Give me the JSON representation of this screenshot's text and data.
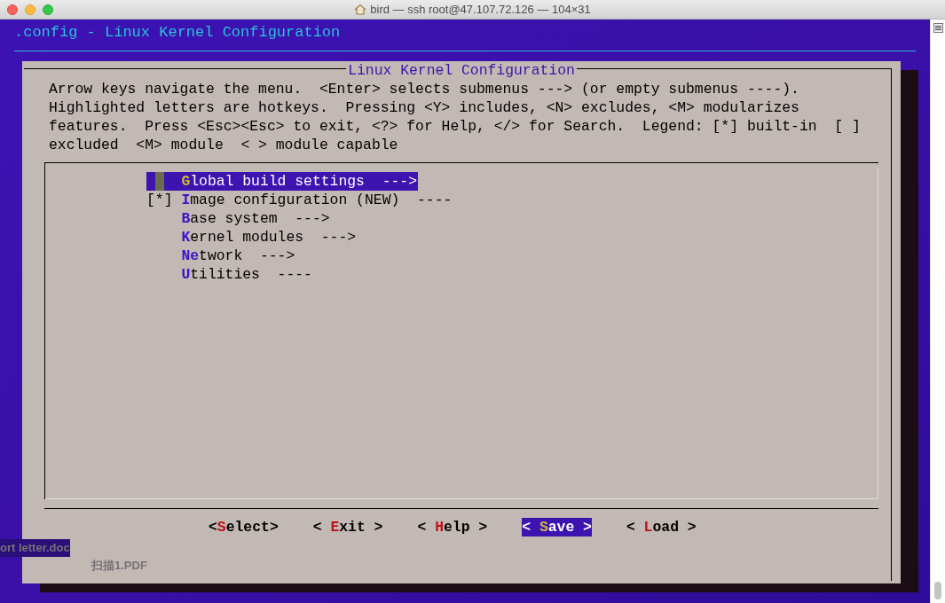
{
  "window": {
    "title": "bird — ssh root@47.107.72.126 — 104×31"
  },
  "header": ".config - Linux Kernel Configuration",
  "dialog": {
    "title": "Linux Kernel Configuration",
    "help_lines": [
      "Arrow keys navigate the menu.  <Enter> selects submenus ---> (or empty submenus ----).",
      "Highlighted letters are hotkeys.  Pressing <Y> includes, <N> excludes, <M> modularizes",
      "features.  Press <Esc><Esc> to exit, <?> for Help, </> for Search.  Legend: [*] built-in  [ ]",
      "excluded  <M> module  < > module capable"
    ],
    "menu": [
      {
        "hotkey": "G",
        "rest": "lobal build settings  --->",
        "selected": true
      },
      {
        "prefix": "[*]",
        "hotkey": "I",
        "rest": "mage configuration (NEW)  ----",
        "selected": false
      },
      {
        "hotkey": "B",
        "rest": "ase system  --->",
        "selected": false
      },
      {
        "hotkey": "K",
        "rest": "ernel modules  --->",
        "selected": false
      },
      {
        "hotkey": "Ne",
        "rest": "twork  --->",
        "selected": false
      },
      {
        "hotkey": "U",
        "rest": "tilities  ----",
        "selected": false
      }
    ],
    "buttons": [
      {
        "open": "<",
        "hotkey": "S",
        "rest": "elect",
        "close": ">",
        "selected": false
      },
      {
        "open": "< ",
        "hotkey": "E",
        "rest": "xit",
        "close": " >",
        "selected": false
      },
      {
        "open": "< ",
        "hotkey": "H",
        "rest": "elp",
        "close": " >",
        "selected": false
      },
      {
        "open": "< ",
        "hotkey": "S",
        "rest": "ave",
        "close": " >",
        "selected": true
      },
      {
        "open": "< ",
        "hotkey": "L",
        "rest": "oad",
        "close": " >",
        "selected": false
      }
    ]
  },
  "desktop_files": [
    {
      "label": "ort letter.doc"
    },
    {
      "label": "扫描1.PDF"
    }
  ]
}
